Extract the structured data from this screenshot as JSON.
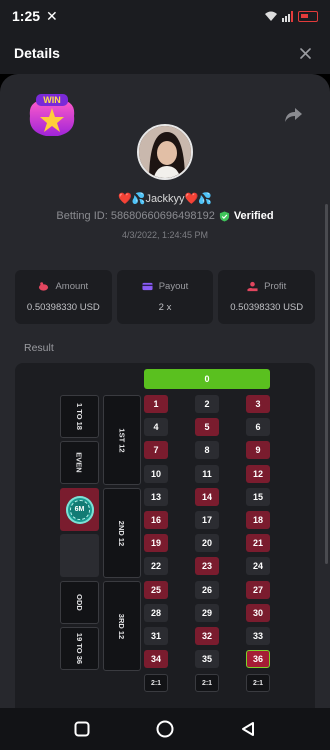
{
  "status": {
    "time": "1:25",
    "x_icon": "✕"
  },
  "header": {
    "title": "Details"
  },
  "profile": {
    "username": "❤️💦Jackkyy❤️💦",
    "betting_id": "Betting ID: 586806606964981​92",
    "verified": "Verified",
    "timestamp": "4/3/2022, 1:24:45 PM"
  },
  "stats": [
    {
      "label": "Amount",
      "value": "0.50398330 USD",
      "icon": "piggy-bank-icon",
      "color": "#e2465f"
    },
    {
      "label": "Payout",
      "value": "2 x",
      "icon": "card-icon",
      "color": "#8a5cf6"
    },
    {
      "label": "Profit",
      "value": "0.50398330 USD",
      "icon": "hand-coins-icon",
      "color": "#e2465f"
    }
  ],
  "result_label": "Result",
  "board": {
    "zero": "0",
    "numbers": [
      [
        "1",
        "red"
      ],
      [
        "2",
        "black"
      ],
      [
        "3",
        "red"
      ],
      [
        "4",
        "black"
      ],
      [
        "5",
        "red"
      ],
      [
        "6",
        "black"
      ],
      [
        "7",
        "red"
      ],
      [
        "8",
        "black"
      ],
      [
        "9",
        "red"
      ],
      [
        "10",
        "black"
      ],
      [
        "11",
        "black"
      ],
      [
        "12",
        "red"
      ],
      [
        "13",
        "black"
      ],
      [
        "14",
        "red"
      ],
      [
        "15",
        "black"
      ],
      [
        "16",
        "red"
      ],
      [
        "17",
        "black"
      ],
      [
        "18",
        "red"
      ],
      [
        "19",
        "red"
      ],
      [
        "20",
        "black"
      ],
      [
        "21",
        "red"
      ],
      [
        "22",
        "black"
      ],
      [
        "23",
        "red"
      ],
      [
        "24",
        "black"
      ],
      [
        "25",
        "red"
      ],
      [
        "26",
        "black"
      ],
      [
        "27",
        "red"
      ],
      [
        "28",
        "black"
      ],
      [
        "29",
        "black"
      ],
      [
        "30",
        "red"
      ],
      [
        "31",
        "black"
      ],
      [
        "32",
        "red"
      ],
      [
        "33",
        "black"
      ],
      [
        "34",
        "red"
      ],
      [
        "35",
        "black"
      ],
      [
        "36",
        "hit"
      ]
    ],
    "dozens": [
      "1ST 12",
      "2ND 12",
      "3RD 12"
    ],
    "sides": [
      "1 TO 18",
      "EVEN",
      "",
      "",
      "ODD",
      "19 TO 36"
    ],
    "column_labels": [
      "2:1",
      "2:1",
      "2:1"
    ],
    "chip_label": "6M"
  },
  "colors": {
    "red": "#7a1c2e",
    "green": "#5ac01f",
    "hit_border": "#7fd12b",
    "verified": "#3fc35a"
  }
}
